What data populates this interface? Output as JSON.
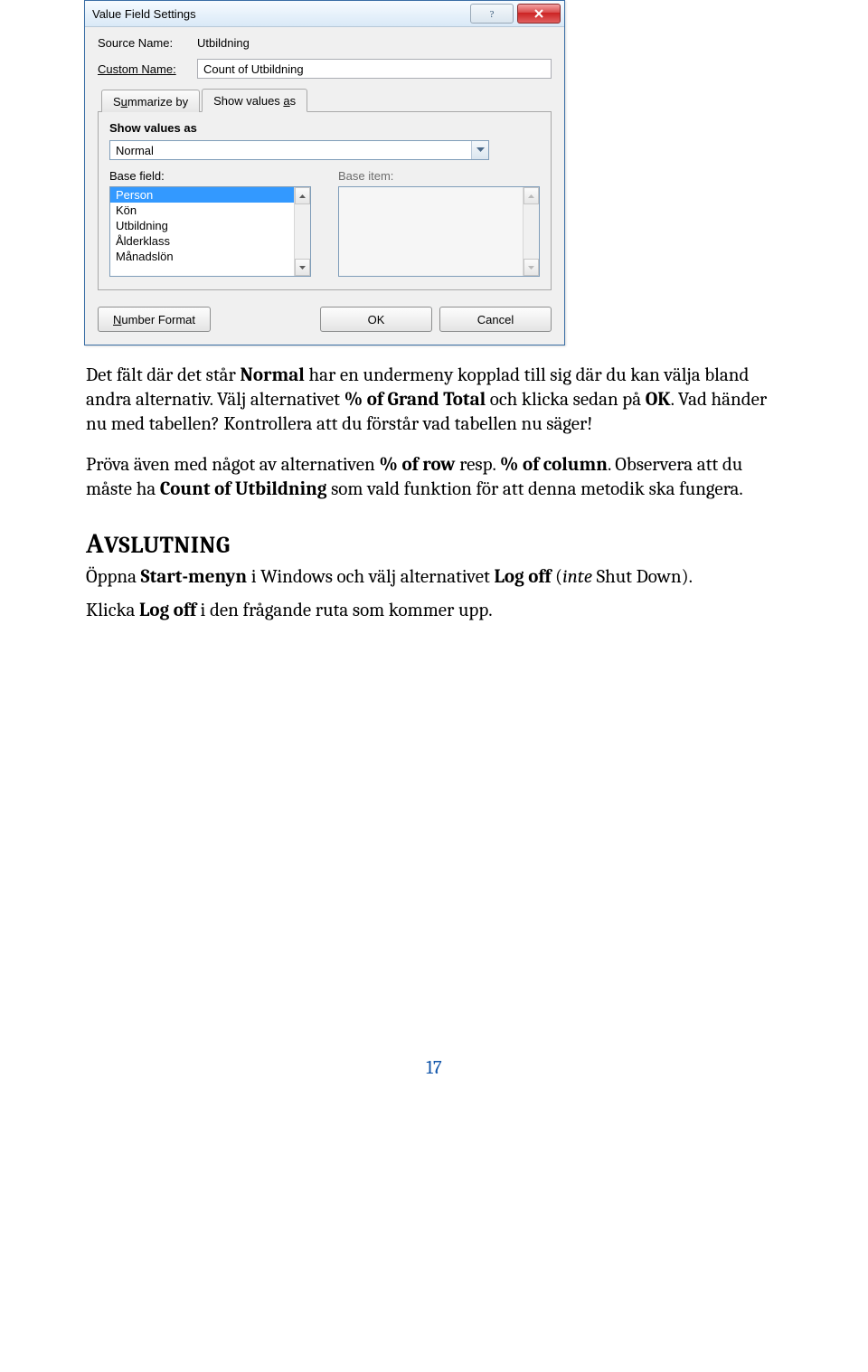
{
  "dialog": {
    "title": "Value Field Settings",
    "source_name_label": "Source Name:",
    "source_name_value": "Utbildning",
    "custom_name_label": "Custom Name:",
    "custom_name_value": "Count of Utbildning",
    "tab1_pre": "S",
    "tab1_under": "u",
    "tab1_post": "mmarize by",
    "tab2_pre": "Show values ",
    "tab2_under": "a",
    "tab2_post": "s",
    "show_values_as_label": "Show values as",
    "combo_value": "Normal",
    "base_field_label": "Base field:",
    "base_item_label": "Base item:",
    "base_fields": [
      "Person",
      "Kön",
      "Utbildning",
      "Ålderklass",
      "Månadslön"
    ],
    "number_format_under": "N",
    "number_format_post": "umber Format",
    "ok": "OK",
    "cancel": "Cancel"
  },
  "text": {
    "p1_a": "Det fält där det står ",
    "p1_b": "Normal",
    "p1_c": " har en undermeny kopplad till sig där du kan välja bland andra alternativ. Välj alternativet ",
    "p1_d": "% of Grand Total ",
    "p1_e": "och klicka sedan på ",
    "p1_f": "OK",
    "p1_g": ". Vad händer nu med tabellen? Kontrollera att du förstår vad tabellen nu säger!",
    "p2_a": "Pröva även med något av alternativen ",
    "p2_b": "% of row",
    "p2_c": " resp. ",
    "p2_d": "% of column",
    "p2_e": ". Observera att du måste ha ",
    "p2_f": "Count of Utbildning",
    "p2_g": " som vald funktion för att denna metodik ska fungera.",
    "h_first": "A",
    "h_rest": "VSLUTNING",
    "p3_a": "Öppna ",
    "p3_b": "Start-menyn",
    "p3_c": " i Windows och välj alternativet ",
    "p3_d": "Log off",
    "p3_e": " (",
    "p3_f": "inte",
    "p3_g": " Shut Down).",
    "p4_a": "Klicka ",
    "p4_b": "Log off",
    "p4_c": " i den frågande ruta som kommer upp.",
    "pagenum": "17"
  }
}
